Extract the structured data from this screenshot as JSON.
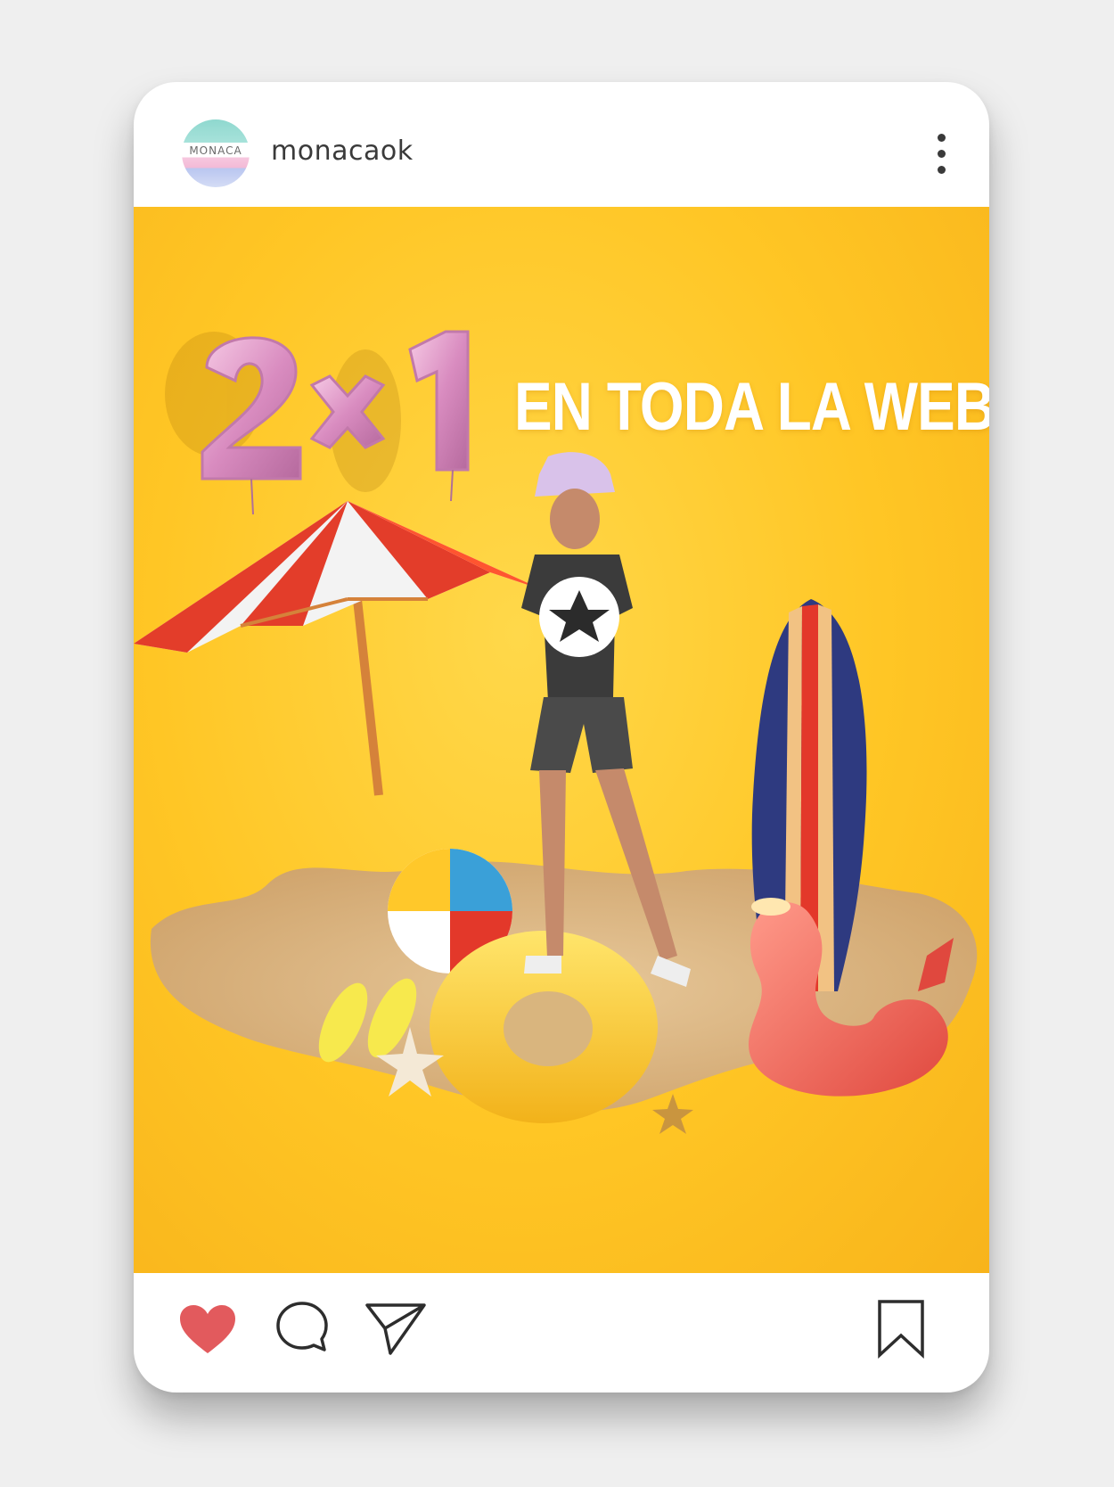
{
  "post": {
    "username": "monacaok",
    "avatar": {
      "label": "MONACA"
    },
    "image": {
      "promo_number": "2×1",
      "promo_text": "EN TODA LA WEB",
      "background_color": "#ffc625"
    },
    "actions": {
      "like_icon": "heart-icon",
      "liked": true,
      "like_color": "#e25a5d",
      "comment_icon": "comment-icon",
      "share_icon": "send-icon",
      "save_icon": "bookmark-icon"
    }
  }
}
